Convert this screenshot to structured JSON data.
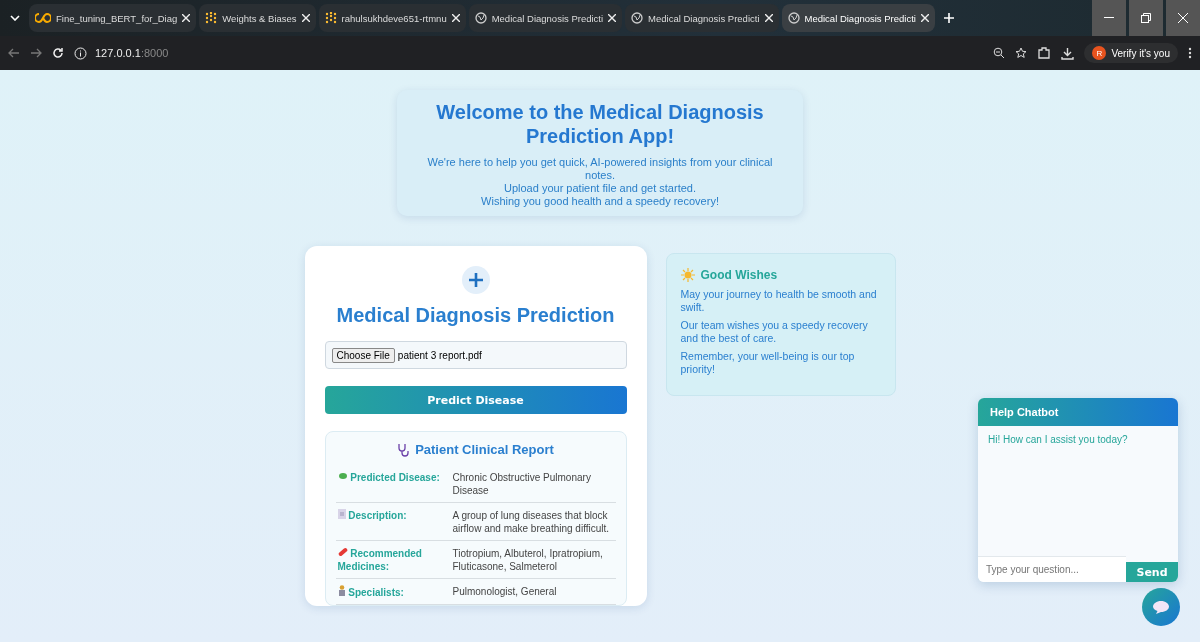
{
  "browser": {
    "tabs": [
      {
        "title": "Fine_tuning_BERT_for_Diag",
        "kind": "colab",
        "selected": false
      },
      {
        "title": "Weights & Biases",
        "kind": "wandb",
        "selected": false
      },
      {
        "title": "rahulsukhdeve651-rtmnu",
        "kind": "wandb",
        "selected": false
      },
      {
        "title": "Medical Diagnosis Predicti",
        "kind": "globe",
        "selected": false
      },
      {
        "title": "Medical Diagnosis Predicti",
        "kind": "globe",
        "selected": false
      },
      {
        "title": "Medical Diagnosis Predicti",
        "kind": "globe",
        "selected": true
      }
    ],
    "address": {
      "host": "127.0.0.1",
      "port": ":8000"
    },
    "profile": {
      "initial": "R",
      "label": "Verify it's you"
    }
  },
  "welcome": {
    "title": "Welcome to the Medical Diagnosis Prediction App!",
    "lines": [
      "We're here to help you get quick, AI-powered insights from your clinical notes.",
      "Upload your patient file and get started.",
      "Wishing you good health and a speedy recovery!"
    ]
  },
  "predictor": {
    "title": "Medical Diagnosis Prediction",
    "file_button": "Choose File",
    "file_name": "patient 3 report.pdf",
    "submit": "Predict Disease",
    "report": {
      "title": "Patient Clinical Report",
      "rows": [
        {
          "kind": "virus",
          "label": "Predicted Disease:",
          "value": "Chronic Obstructive Pulmonary Disease"
        },
        {
          "kind": "document",
          "label": "Description:",
          "value": "A group of lung diseases that block airflow and make breathing difficult."
        },
        {
          "kind": "pill",
          "label": "Recommended Medicines:",
          "value": "Tiotropium, Albuterol, Ipratropium, Fluticasone, Salmeterol"
        },
        {
          "kind": "person",
          "label": "Specialists:",
          "value": "Pulmonologist, General"
        }
      ]
    }
  },
  "wishes": {
    "title": "Good Wishes",
    "lines": [
      "May your journey to health be smooth and swift.",
      "Our team wishes you a speedy recovery and the best of care.",
      "Remember, your well-being is our top priority!"
    ]
  },
  "chatbot": {
    "title": "Help Chatbot",
    "messages": [
      "Hi! How can I assist you today?"
    ],
    "placeholder": "Type your question...",
    "send": "Send"
  }
}
